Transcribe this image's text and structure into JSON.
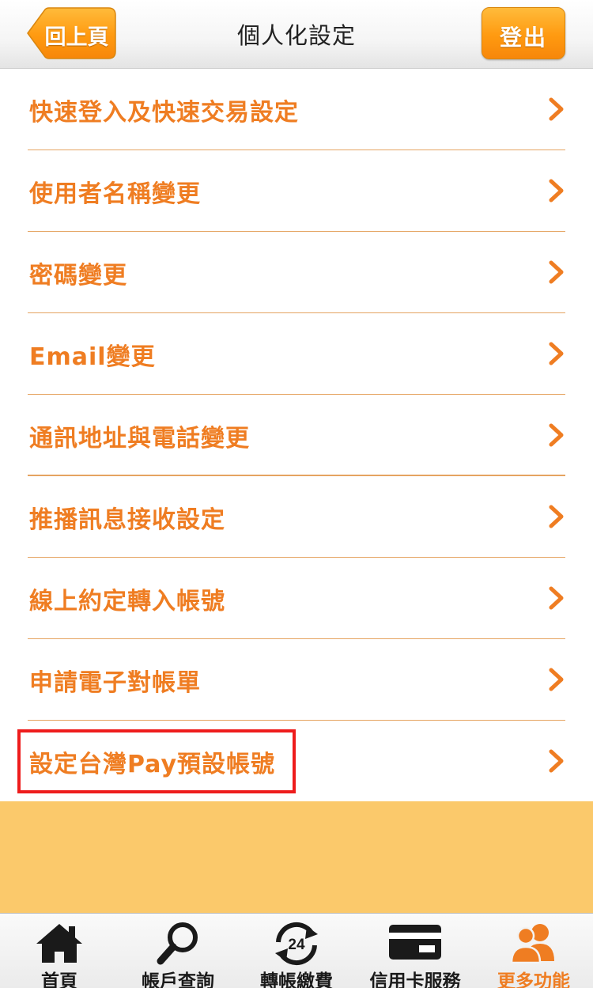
{
  "header": {
    "title": "個人化設定",
    "back_label": "回上頁",
    "logout_label": "登出"
  },
  "menu": {
    "items": [
      {
        "label": "快速登入及快速交易設定"
      },
      {
        "label": "使用者名稱變更"
      },
      {
        "label": "密碼變更"
      },
      {
        "label": "Email變更"
      },
      {
        "label": "通訊地址與電話變更"
      },
      {
        "label": "推播訊息接收設定"
      },
      {
        "label": "線上約定轉入帳號"
      },
      {
        "label": "申請電子對帳單"
      },
      {
        "label": "設定台灣Pay預設帳號"
      }
    ]
  },
  "tabbar": {
    "tabs": [
      {
        "label": "首頁",
        "icon": "home-icon"
      },
      {
        "label": "帳戶查詢",
        "icon": "search-icon"
      },
      {
        "label": "轉帳繳費",
        "icon": "transfer-24-icon",
        "icon_text": "24"
      },
      {
        "label": "信用卡服務",
        "icon": "credit-card-icon"
      },
      {
        "label": "更多功能",
        "icon": "people-icon",
        "active": true
      }
    ]
  },
  "colors": {
    "accent": "#ef7d22",
    "divider": "#e5a461",
    "filler": "#fbc96b",
    "highlight": "#ee1c1c"
  }
}
